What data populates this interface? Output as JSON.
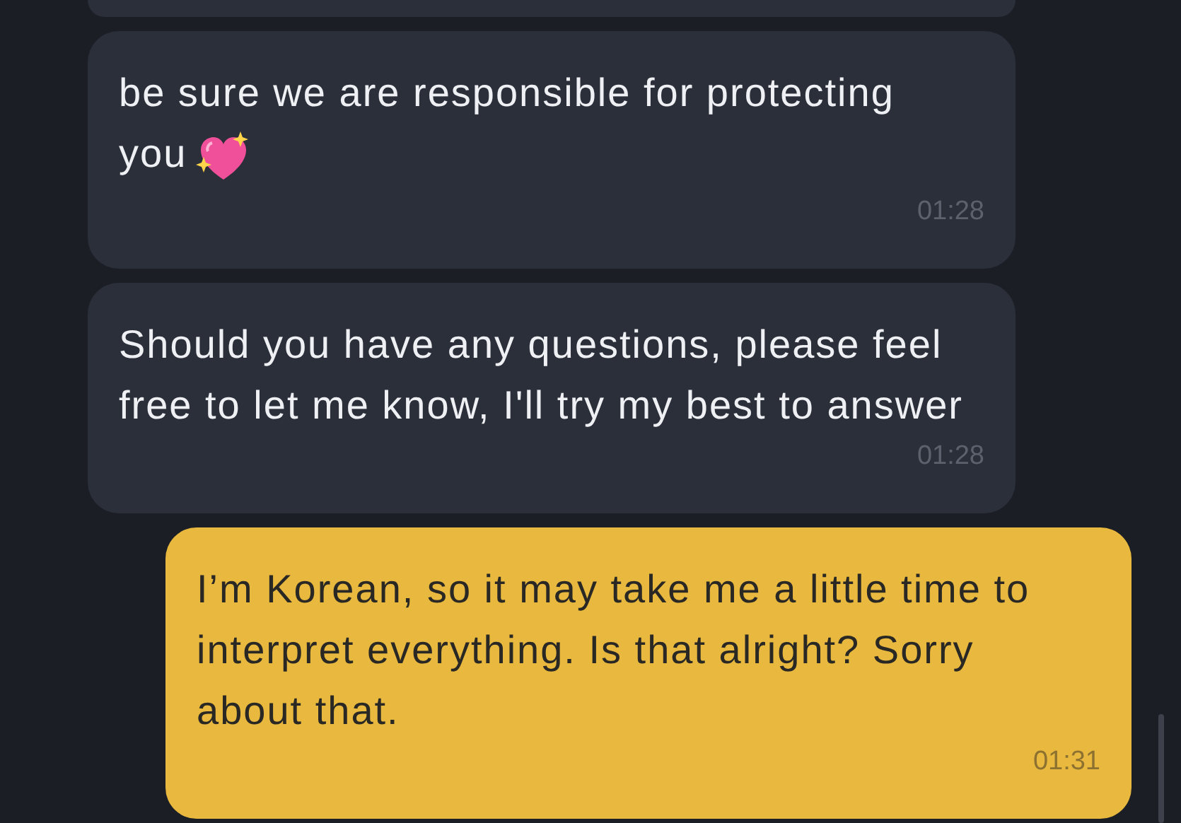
{
  "messages": [
    {
      "kind": "incoming_cut_off"
    },
    {
      "kind": "incoming",
      "text": "be sure we are responsible for protecting you",
      "emoji": true,
      "time": "01:28"
    },
    {
      "kind": "incoming",
      "text": "Should you have any questions, please feel free to let me know, I'll try my best to answer",
      "time": "01:28"
    },
    {
      "kind": "outgoing",
      "text": "I’m Korean, so it may take me a little time to interpret everything. Is that alright? Sorry about that.",
      "time": "01:31"
    }
  ]
}
